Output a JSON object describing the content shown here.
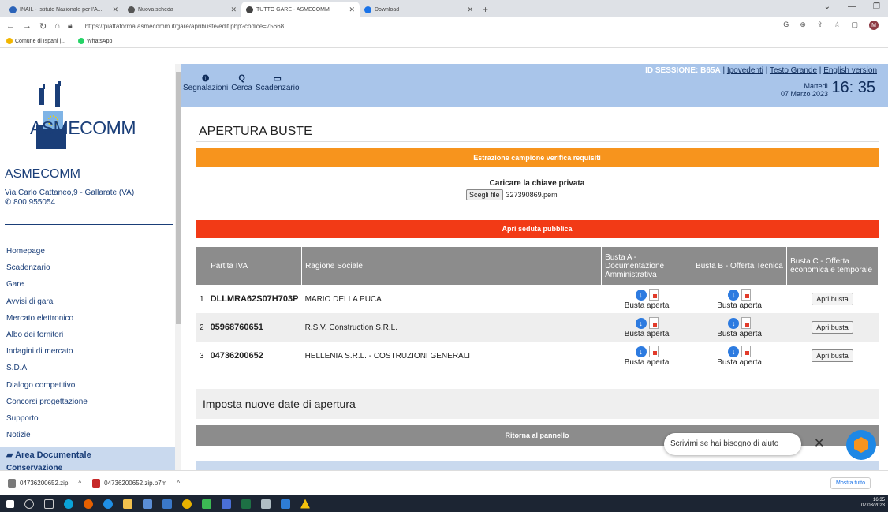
{
  "browser": {
    "tabs": [
      {
        "title": "INAIL - Istituto Nazionale per l'A...",
        "color": "#2b63b8",
        "active": false
      },
      {
        "title": "Nuova scheda",
        "color": "#555555",
        "active": false
      },
      {
        "title": "TUTTO GARE - ASMECOMM",
        "color": "#444444",
        "active": true
      },
      {
        "title": "Download",
        "color": "#1a73e8",
        "active": false
      }
    ],
    "url": "https://piattaforma.asmecomm.it/gare/apribuste/edit.php?codice=75668",
    "bookmarks": [
      {
        "label": "Comune di Ispani |...",
        "color": "#f2b600"
      },
      {
        "label": "WhatsApp",
        "color": "#25d366"
      }
    ],
    "profile_initial": "M"
  },
  "sidebar": {
    "logo_text": "ASMECOMM",
    "org_name": "ASMECOMM",
    "address": "Via Carlo Cattaneo,9 - Gallarate (VA)",
    "phone": "800 955054",
    "menu": [
      "Homepage",
      "Scadenzario",
      "Gare",
      "Avvisi di gara",
      "Mercato elettronico",
      "Albo dei fornitori",
      "Indagini di mercato",
      "S.D.A.",
      "Dialogo competitivo",
      "Concorsi progettazione",
      "Supporto",
      "Notizie"
    ],
    "area_documentale": "Area Documentale",
    "area_next": "Conservazione"
  },
  "header": {
    "icons": [
      {
        "glyph": "❶",
        "label": "Segnalazioni"
      },
      {
        "glyph": "Q",
        "label": "Cerca"
      },
      {
        "glyph": "▭",
        "label": "Scadenzario"
      }
    ],
    "session_label": "ID SESSIONE: B65A",
    "links": [
      "Ipovedenti",
      "Testo Grande",
      "English version"
    ],
    "weekday": "Martedì",
    "date": "07 Marzo 2023",
    "time": "16: 35"
  },
  "main": {
    "title": "APERTURA BUSTE",
    "extract_bar": "Estrazione campione verifica requisiti",
    "key_label": "Caricare la chiave privata",
    "file_button": "Scegli file",
    "file_name": "327390869.pem",
    "open_session_bar": "Apri seduta pubblica",
    "columns": [
      "Partita IVA",
      "Ragione Sociale",
      "Busta A - Documentazione Amministrativa",
      "Busta B - Offerta Tecnica",
      "Busta C - Offerta economica e temporale"
    ],
    "rows": [
      {
        "n": "1",
        "piva": "DLLMRA62S07H703P",
        "ragione": "MARIO DELLA PUCA",
        "busta_a": "Busta aperta",
        "busta_b": "Busta aperta",
        "busta_c": "Apri busta"
      },
      {
        "n": "2",
        "piva": "05968760651",
        "ragione": "R.S.V. Construction S.R.L.",
        "busta_a": "Busta aperta",
        "busta_b": "Busta aperta",
        "busta_c": "Apri busta"
      },
      {
        "n": "3",
        "piva": "04736200652",
        "ragione": "HELLENIA S.R.L. - COSTRUZIONI GENERALI",
        "busta_a": "Busta aperta",
        "busta_b": "Busta aperta",
        "busta_c": "Apri busta"
      }
    ],
    "new_dates": "Imposta nuove date di apertura",
    "back_bar": "Ritorna al pannello"
  },
  "chat": {
    "text": "Scrivimi se hai bisogno di aiuto"
  },
  "downloads": {
    "items": [
      {
        "name": "04736200652.zip",
        "color": "#7a7a7a"
      },
      {
        "name": "04736200652.zip.p7m",
        "color": "#c62828"
      }
    ],
    "show_all": "Mostra tutto"
  },
  "taskbar": {
    "time": "16:35",
    "date": "07/03/2023"
  },
  "colors": {
    "orange": "#f7941d",
    "red": "#f23a16",
    "header": "#a9c5ea",
    "brand": "#1a3e78"
  }
}
